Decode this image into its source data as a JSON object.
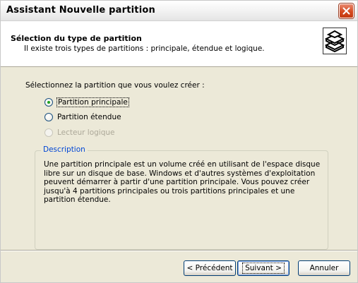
{
  "window": {
    "title": "Assistant Nouvelle partition"
  },
  "header": {
    "title": "Sélection du type de partition",
    "subtitle": "Il existe trois types de partitions : principale, étendue et logique.",
    "icon": "disk-stack-icon"
  },
  "main": {
    "prompt": "Sélectionnez la partition que vous voulez créer :",
    "options": [
      {
        "label": "Partition principale",
        "selected": true,
        "enabled": true
      },
      {
        "label": "Partition étendue",
        "selected": false,
        "enabled": true
      },
      {
        "label": "Lecteur logique",
        "selected": false,
        "enabled": false
      }
    ],
    "description_title": "Description",
    "description_text": "Une partition principale est un volume créé en utilisant de l'espace disque libre sur un disque de base. Windows et d'autres systèmes d'exploitation peuvent démarrer à partir d'une partition principale. Vous pouvez créer jusqu'à 4 partitions principales ou trois partitions principales et une partition étendue."
  },
  "footer": {
    "back_label": "< Précédent",
    "next_label": "Suivant >",
    "cancel_label": "Annuler"
  },
  "colors": {
    "dialog_bg": "#ece9d8",
    "group_title": "#0046d5",
    "close_button": "#d5491f"
  }
}
